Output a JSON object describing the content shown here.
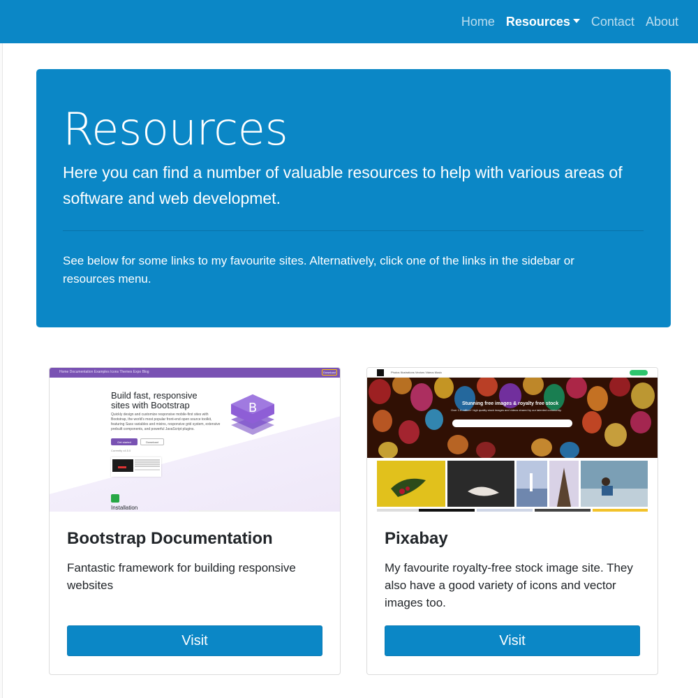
{
  "navbar": {
    "links": [
      {
        "label": "Home"
      },
      {
        "label": "Resources"
      },
      {
        "label": "Contact"
      },
      {
        "label": "About"
      }
    ],
    "active_index": 1
  },
  "jumbotron": {
    "title": "Resources",
    "lead": "Here you can find a number of valuable resources to help with various areas of software and web developmet.",
    "text": "See below for some links to my favourite sites. Alternatively, click one of the links in the sidebar or resources menu."
  },
  "cards": [
    {
      "title": "Bootstrap Documentation",
      "text": "Fantastic framework for building responsive websites",
      "button": "Visit",
      "thumbnail": {
        "nav_items": "Home   Documentation   Examples   Icons   Themes   Expo   Blog",
        "download": "Download",
        "heading_line1": "Build fast, responsive",
        "heading_line2": "sites with Bootstrap",
        "description": "Quickly design and customize responsive mobile-first sites with Bootstrap, the world's most popular front-end open source toolkit, featuring Sass variables and mixins, responsive grid system, extensive prebuilt components, and powerful JavaScript plugins.",
        "primary_btn": "Get started",
        "secondary_btn": "Download",
        "version": "Currently v4.5.0",
        "section": "Installation"
      }
    },
    {
      "title": "Pixabay",
      "text": "My favourite royalty-free stock image site. They also have a good variety of icons and vector images too.",
      "button": "Visit",
      "thumbnail": {
        "nav_items": "Photos    Illustrations    Vectors    Videos    Music",
        "hero_title": "Stunning free images & royalty free stock",
        "hero_sub": "Over 1.8 million+ high quality stock images and videos shared by our talented community."
      }
    }
  ],
  "colors": {
    "primary": "#0b87c6",
    "bootstrap_purple": "#7952b3",
    "pixabay_green": "#2ec66d"
  }
}
